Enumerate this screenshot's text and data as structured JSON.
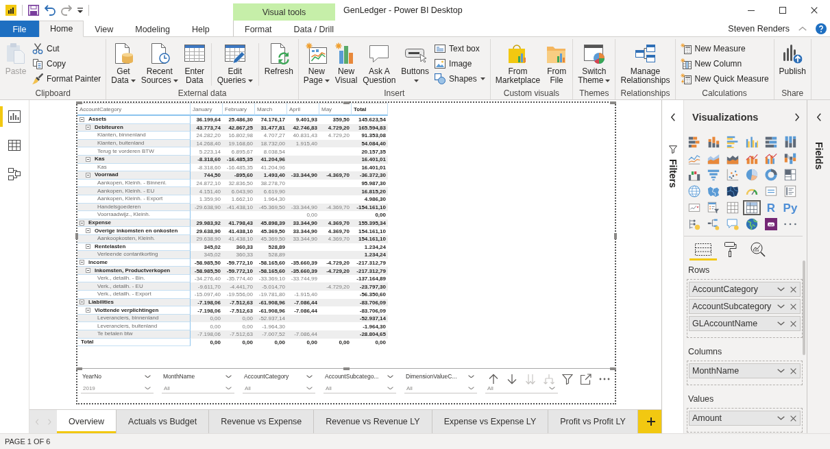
{
  "window": {
    "title": "GenLedger - Power BI Desktop",
    "context_header": "Visual tools"
  },
  "quick_access": [
    {
      "disabled": false
    },
    {
      "disabled": false
    },
    {
      "disabled": true
    },
    {
      "disabled": false
    }
  ],
  "ribbon": {
    "tabs": [
      {
        "label": "File",
        "kind": "file",
        "selected": false
      },
      {
        "label": "Home",
        "kind": "tab",
        "selected": true
      },
      {
        "label": "View",
        "kind": "tab",
        "selected": false
      },
      {
        "label": "Modeling",
        "kind": "tab",
        "selected": false
      },
      {
        "label": "Help",
        "kind": "tab",
        "selected": false
      },
      {
        "label": "Format",
        "kind": "context",
        "selected": false
      },
      {
        "label": "Data / Drill",
        "kind": "context",
        "selected": false
      }
    ],
    "user": "Steven Renders",
    "groups": [
      {
        "label": "Clipboard",
        "items": [
          {
            "kind": "large",
            "lines": [
              "Paste"
            ],
            "dropdown": false,
            "disabled": true
          },
          {
            "kind": "stack",
            "items": [
              {
                "label": "Cut",
                "dropdown": false,
                "disabled": false
              },
              {
                "label": "Copy",
                "dropdown": false,
                "disabled": false
              },
              {
                "label": "Format Painter",
                "dropdown": false,
                "disabled": false
              }
            ]
          }
        ]
      },
      {
        "label": "External data",
        "items": [
          {
            "kind": "large",
            "lines": [
              "Get",
              "Data"
            ],
            "dropdown": true,
            "disabled": false
          },
          {
            "kind": "large",
            "lines": [
              "Recent",
              "Sources"
            ],
            "dropdown": true,
            "disabled": false
          },
          {
            "kind": "large",
            "lines": [
              "Enter",
              "Data"
            ],
            "dropdown": false,
            "disabled": false
          },
          {
            "kind": "separator"
          },
          {
            "kind": "large",
            "lines": [
              "Edit",
              "Queries"
            ],
            "dropdown": true,
            "disabled": false
          },
          {
            "kind": "separator"
          },
          {
            "kind": "large",
            "lines": [
              "Refresh"
            ],
            "dropdown": false,
            "disabled": false
          }
        ]
      },
      {
        "label": "Insert",
        "items": [
          {
            "kind": "large",
            "lines": [
              "New",
              "Page"
            ],
            "dropdown": true,
            "disabled": false
          },
          {
            "kind": "large",
            "lines": [
              "New",
              "Visual"
            ],
            "dropdown": false,
            "disabled": false
          },
          {
            "kind": "large",
            "lines": [
              "Ask A",
              "Question"
            ],
            "dropdown": false,
            "disabled": false
          },
          {
            "kind": "large",
            "lines": [
              "Buttons"
            ],
            "dropdown": true,
            "disabled": false
          },
          {
            "kind": "stack",
            "items": [
              {
                "label": "Text box",
                "dropdown": false,
                "disabled": false
              },
              {
                "label": "Image",
                "dropdown": false,
                "disabled": false
              },
              {
                "label": "Shapes",
                "dropdown": true,
                "disabled": false
              }
            ]
          }
        ]
      },
      {
        "label": "Custom visuals",
        "items": [
          {
            "kind": "large",
            "lines": [
              "From",
              "Marketplace"
            ],
            "dropdown": false,
            "disabled": false
          },
          {
            "kind": "large",
            "lines": [
              "From",
              "File"
            ],
            "dropdown": false,
            "disabled": false
          }
        ]
      },
      {
        "label": "Themes",
        "items": [
          {
            "kind": "large",
            "lines": [
              "Switch",
              "Theme"
            ],
            "dropdown": true,
            "disabled": false
          }
        ]
      },
      {
        "label": "Relationships",
        "items": [
          {
            "kind": "large",
            "lines": [
              "Manage",
              "Relationships"
            ],
            "dropdown": false,
            "disabled": false
          }
        ]
      },
      {
        "label": "Calculations",
        "items": [
          {
            "kind": "stack",
            "items": [
              {
                "label": "New Measure",
                "dropdown": false,
                "disabled": false
              },
              {
                "label": "New Column",
                "dropdown": false,
                "disabled": false
              },
              {
                "label": "New Quick Measure",
                "dropdown": false,
                "disabled": false
              }
            ]
          }
        ]
      },
      {
        "label": "Share",
        "items": [
          {
            "kind": "large",
            "lines": [
              "Publish"
            ],
            "dropdown": false,
            "disabled": false
          }
        ]
      }
    ]
  },
  "views": [
    {
      "selected": true
    },
    {
      "selected": false
    },
    {
      "selected": false
    }
  ],
  "matrix": {
    "columns": [
      "AccountCategory",
      "January",
      "February",
      "March",
      "April",
      "May",
      "Total"
    ],
    "rows": [
      {
        "label": "Assets",
        "expanded": true,
        "values": {
          "january": "36.199,64",
          "february": "25.486,30",
          "march": "74.176,17",
          "april": "9.401,93",
          "may": "359,50",
          "total": "145.623,54"
        },
        "children": [
          {
            "label": "Debiteuren",
            "expanded": true,
            "values": {
              "january": "43.773,74",
              "february": "42.867,25",
              "march": "31.477,81",
              "april": "42.746,83",
              "may": "4.729,20",
              "total": "165.594,83"
            },
            "children": [
              {
                "label": "Klanten, binnenland",
                "values": {
                  "january": "24.282,20",
                  "february": "16.802,98",
                  "march": "4.707,27",
                  "april": "40.831,43",
                  "may": "4.729,20",
                  "total": "91.353,08"
                }
              },
              {
                "label": "Klanten, buitenland",
                "values": {
                  "january": "14.268,40",
                  "february": "19.168,60",
                  "march": "18.732,00",
                  "april": "1.915,40",
                  "total": "54.084,40"
                }
              },
              {
                "label": "Terug te vorderen BTW",
                "values": {
                  "january": "5.223,14",
                  "february": "6.895,67",
                  "march": "8.038,54",
                  "total": "20.157,35"
                }
              }
            ]
          },
          {
            "label": "Kas",
            "expanded": true,
            "values": {
              "january": "-8.318,60",
              "february": "-16.485,35",
              "march": "41.204,96",
              "total": "16.401,01"
            },
            "children": [
              {
                "label": "Kas",
                "values": {
                  "january": "-8.318,60",
                  "february": "-16.485,35",
                  "march": "41.204,96",
                  "total": "16.401,01"
                }
              }
            ]
          },
          {
            "label": "Voorraad",
            "expanded": true,
            "values": {
              "january": "744,50",
              "february": "-895,60",
              "march": "1.493,40",
              "april": "-33.344,90",
              "may": "-4.369,70",
              "total": "-36.372,30"
            },
            "children": [
              {
                "label": "Aankopen, Kleinh. - Binnenl.",
                "values": {
                  "january": "24.872,10",
                  "february": "32.836,50",
                  "march": "38.278,70",
                  "total": "95.987,30"
                }
              },
              {
                "label": "Aankopen, Kleinh. - EU",
                "values": {
                  "january": "4.151,40",
                  "february": "6.043,90",
                  "march": "6.619,90",
                  "total": "16.815,20"
                }
              },
              {
                "label": "Aankopen, Kleinh. - Export",
                "values": {
                  "january": "1.359,90",
                  "february": "1.662,10",
                  "march": "1.964,30",
                  "total": "4.986,30"
                }
              },
              {
                "label": "Handelsgoederen",
                "values": {
                  "january": "-29.638,90",
                  "february": "-41.438,10",
                  "march": "-45.369,50",
                  "april": "-33.344,90",
                  "may": "-4.369,70",
                  "total": "-154.161,10"
                }
              },
              {
                "label": "Voorraadwijz., Kleinh.",
                "values": {
                  "april": "0,00",
                  "total": "0,00"
                }
              }
            ]
          }
        ]
      },
      {
        "label": "Expense",
        "expanded": true,
        "values": {
          "january": "29.983,92",
          "february": "41.798,43",
          "march": "45.898,39",
          "april": "33.344,90",
          "may": "4.369,70",
          "total": "155.395,34"
        },
        "children": [
          {
            "label": "Overige inkomsten en onkosten",
            "expanded": true,
            "values": {
              "january": "29.638,90",
              "february": "41.438,10",
              "march": "45.369,50",
              "april": "33.344,90",
              "may": "4.369,70",
              "total": "154.161,10"
            },
            "children": [
              {
                "label": "Aankoopkosten, Kleinh.",
                "values": {
                  "january": "29.638,90",
                  "february": "41.438,10",
                  "march": "45.369,50",
                  "april": "33.344,90",
                  "may": "4.369,70",
                  "total": "154.161,10"
                }
              }
            ]
          },
          {
            "label": "Rentelasten",
            "expanded": true,
            "values": {
              "january": "345,02",
              "february": "360,33",
              "march": "528,89",
              "total": "1.234,24"
            },
            "children": [
              {
                "label": "Verleende contantkorting",
                "values": {
                  "january": "345,02",
                  "february": "360,33",
                  "march": "528,89",
                  "total": "1.234,24"
                }
              }
            ]
          }
        ]
      },
      {
        "label": "Income",
        "expanded": true,
        "values": {
          "january": "-58.985,50",
          "february": "-59.772,10",
          "march": "-58.165,60",
          "april": "-35.660,39",
          "may": "-4.729,20",
          "total": "-217.312,79"
        },
        "children": [
          {
            "label": "Inkomsten, Productverkopen",
            "expanded": true,
            "values": {
              "january": "-58.985,50",
              "february": "-59.772,10",
              "march": "-58.165,60",
              "april": "-35.660,39",
              "may": "-4.729,20",
              "total": "-217.312,79"
            },
            "children": [
              {
                "label": "Verk., detailh. - Bin.",
                "values": {
                  "january": "-34.276,40",
                  "february": "-35.774,40",
                  "march": "-33.369,10",
                  "april": "-33.744,99",
                  "total": "-137.164,89"
                }
              },
              {
                "label": "Verk., detailh. - EU",
                "values": {
                  "january": "-9.611,70",
                  "february": "-4.441,70",
                  "march": "-5.014,70",
                  "may": "-4.729,20",
                  "total": "-23.797,30"
                }
              },
              {
                "label": "Verk., detailh. - Export",
                "values": {
                  "january": "-15.097,40",
                  "february": "-19.556,00",
                  "march": "-19.781,80",
                  "april": "-1.915,40",
                  "total": "-56.350,60"
                }
              }
            ]
          }
        ]
      },
      {
        "label": "Liabilities",
        "expanded": true,
        "values": {
          "january": "-7.198,06",
          "february": "-7.512,63",
          "march": "-61.908,96",
          "april": "-7.086,44",
          "total": "-83.706,09"
        },
        "children": [
          {
            "label": "Vlottende verplichtingen",
            "expanded": true,
            "values": {
              "january": "-7.198,06",
              "february": "-7.512,63",
              "march": "-61.908,96",
              "april": "-7.086,44",
              "total": "-83.706,09"
            },
            "children": [
              {
                "label": "Leveranciers, binnenland",
                "values": {
                  "january": "0,00",
                  "february": "0,00",
                  "march": "-52.937,14",
                  "total": "-52.937,14"
                }
              },
              {
                "label": "Leveranciers, buitenland",
                "values": {
                  "january": "0,00",
                  "february": "0,00",
                  "march": "-1.964,30",
                  "total": "-1.964,30"
                }
              },
              {
                "label": "Te betalen btw",
                "values": {
                  "january": "-7.198,06",
                  "february": "-7.512,63",
                  "march": "-7.007,52",
                  "april": "-7.086,44",
                  "total": "-28.804,65"
                }
              }
            ]
          }
        ]
      }
    ],
    "total": {
      "label": "Total",
      "values": {
        "january": "0,00",
        "february": "0,00",
        "march": "0,00",
        "april": "0,00",
        "may": "0,00",
        "total": "0,00"
      }
    }
  },
  "slicers": [
    {
      "title": "YearNo",
      "value": "2019"
    },
    {
      "title": "MonthName",
      "value": "All"
    },
    {
      "title": "AccountCategory",
      "value": "All"
    },
    {
      "title": "AccountSubcatego...",
      "value": "All"
    },
    {
      "title": "DimensionValueC...",
      "value": "All"
    },
    {
      "value": "All"
    }
  ],
  "visual_header": [
    {
      "disabled": false
    },
    {
      "disabled": false
    },
    {
      "disabled": true
    },
    {
      "disabled": true
    },
    {
      "disabled": false
    },
    {
      "disabled": false
    },
    {
      "disabled": false
    }
  ],
  "page_nav": [
    {
      "disabled": true
    },
    {
      "disabled": true
    }
  ],
  "pages": [
    {
      "label": "Overview",
      "selected": true
    },
    {
      "label": "Actuals vs Budget",
      "selected": false
    },
    {
      "label": "Revenue vs Expense",
      "selected": false
    },
    {
      "label": "Revenue vs Revenue LY",
      "selected": false
    },
    {
      "label": "Expense vs Expense LY",
      "selected": false
    },
    {
      "label": "Profit vs Profit LY",
      "selected": false
    }
  ],
  "filters_pane": {
    "title": "Filters"
  },
  "visualizations": {
    "title": "Visualizations",
    "gallery": [
      {
        "selected": false
      },
      {
        "selected": false
      },
      {
        "selected": false
      },
      {
        "selected": false
      },
      {
        "selected": false
      },
      {
        "selected": false
      },
      {
        "selected": false
      },
      {
        "selected": false
      },
      {
        "selected": false
      },
      {
        "selected": false
      },
      {
        "selected": false
      },
      {
        "selected": false
      },
      {
        "selected": false
      },
      {
        "selected": false
      },
      {
        "selected": false
      },
      {
        "selected": false
      },
      {
        "selected": false
      },
      {
        "selected": false
      },
      {
        "selected": false
      },
      {
        "selected": false
      },
      {
        "selected": false
      },
      {
        "selected": false
      },
      {
        "selected": false
      },
      {
        "selected": false
      },
      {
        "selected": false
      },
      {
        "selected": false
      },
      {
        "selected": false
      },
      {
        "selected": true
      },
      {
        "selected": false,
        "glyph": "R"
      },
      {
        "selected": false,
        "glyph": "Py"
      },
      {
        "selected": false
      },
      {
        "selected": false
      },
      {
        "selected": false
      },
      {
        "selected": false
      },
      {
        "selected": false
      },
      {
        "selected": false
      }
    ],
    "well_tabs": [
      {
        "selected": true
      },
      {
        "selected": false
      },
      {
        "selected": false
      }
    ],
    "wells": [
      {
        "label": "Rows",
        "fields": [
          "AccountCategory",
          "AccountSubcategory",
          "GLAccountName"
        ]
      },
      {
        "label": "Columns",
        "fields": [
          "MonthName"
        ]
      },
      {
        "label": "Values",
        "fields": [
          "Amount"
        ]
      }
    ]
  },
  "fields_pane": {
    "title": "Fields"
  },
  "status_bar": {
    "text": "PAGE 1 OF 6"
  }
}
